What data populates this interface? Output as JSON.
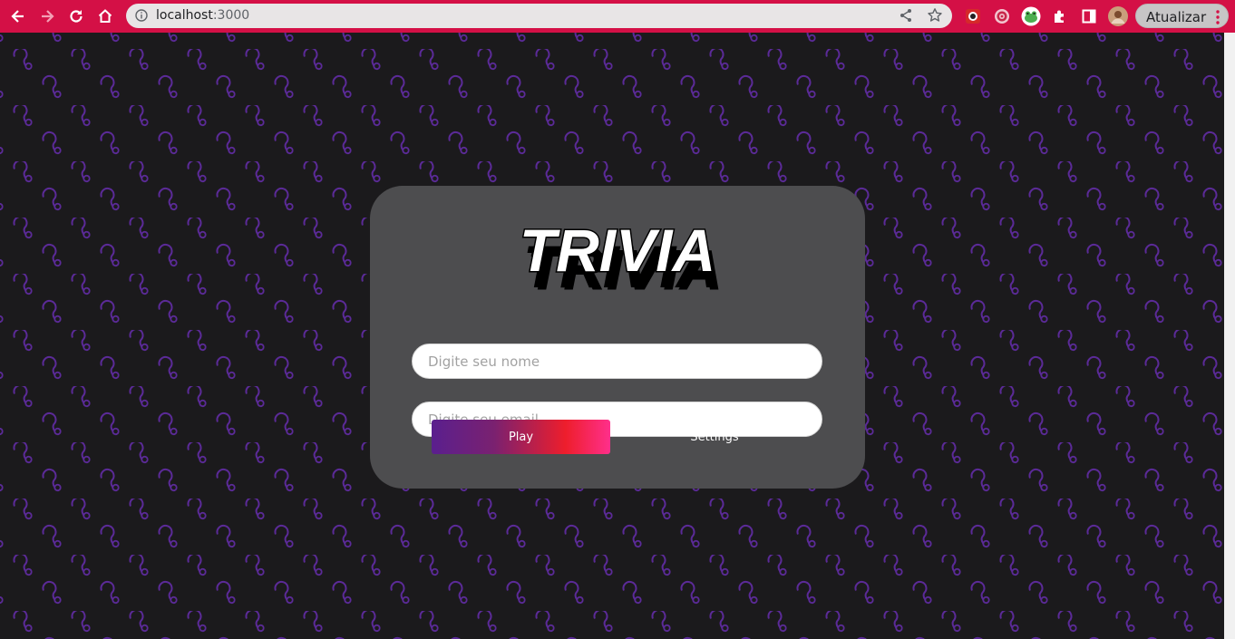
{
  "browser": {
    "url_host": "localhost",
    "url_port": ":3000",
    "update_label": "Atualizar",
    "accent": "#d41046"
  },
  "icons": [
    "back-icon",
    "forward-icon",
    "reload-icon",
    "home-icon",
    "site-info-icon",
    "share-icon",
    "bookmark-star-icon",
    "extension-badge-icon",
    "extension-target-icon",
    "extension-frog-icon",
    "extensions-puzzle-icon",
    "side-panel-icon",
    "profile-avatar-icon",
    "menu-dots-icon",
    "question-mark-pattern-icon"
  ],
  "login": {
    "logo_text": "TRIVIA",
    "name_placeholder": "Digite seu nome",
    "email_placeholder": "Digite seu email",
    "play_label": "Play",
    "settings_label": "Settings"
  },
  "colors": {
    "background": "#1b1a1c",
    "pattern": "#5b2a98",
    "card": "#4d4d4f",
    "play_gradient": [
      "#5a1f8e",
      "#ee1e2c",
      "#ff2f8b"
    ]
  }
}
